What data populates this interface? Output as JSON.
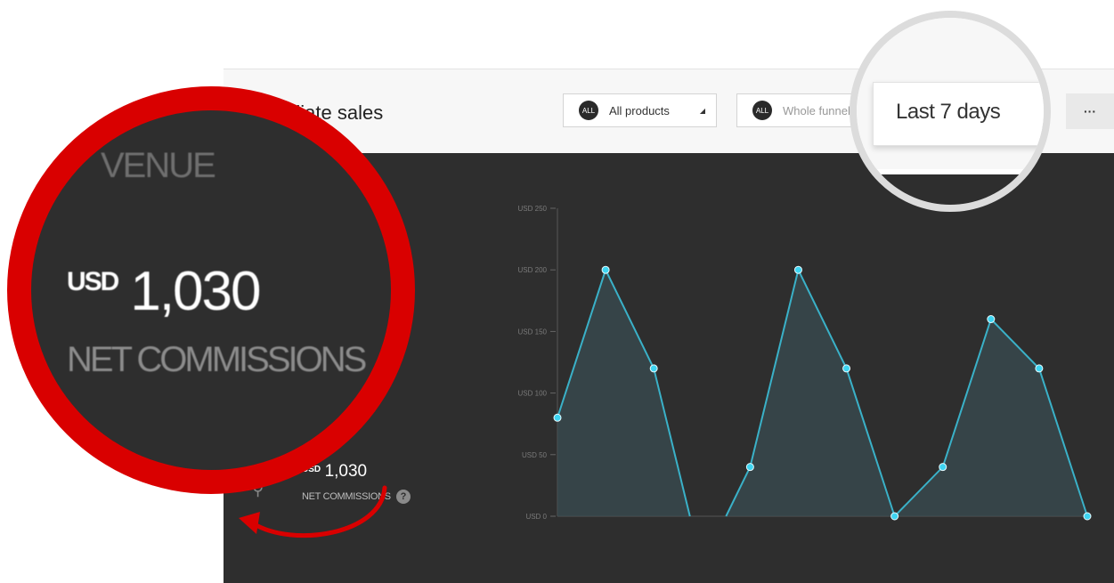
{
  "header": {
    "title": "Affiliate sales",
    "products_filter": {
      "badge": "ALL",
      "label": "All products"
    },
    "funnel_filter": {
      "badge": "ALL",
      "label": "Whole funnel"
    },
    "date_range": "Last 7 days",
    "more_label": "···"
  },
  "stats": {
    "currency": "USD",
    "amount": "1,030",
    "label": "NET COMMISSIONS",
    "help": "?"
  },
  "zoom": {
    "revenue_fragment": "VENUE",
    "currency": "USD",
    "amount": "1,030",
    "label": "NET COMMISSIONS"
  },
  "colors": {
    "accent": "#d90000",
    "line": "#3ab1c8",
    "point": "#3ed5f2",
    "panel": "#2e2e2e"
  },
  "chart_data": {
    "type": "area",
    "y_ticks": [
      "USD 0",
      "USD 50",
      "USD 100",
      "USD 150",
      "USD 200",
      "USD 250"
    ],
    "ylim": [
      0,
      250
    ],
    "segments": [
      [
        [
          0,
          80
        ],
        [
          1,
          200
        ],
        [
          2,
          120
        ],
        [
          2.75,
          0
        ]
      ],
      [
        [
          3.5,
          0
        ],
        [
          4,
          40
        ],
        [
          5,
          200
        ],
        [
          6,
          120
        ],
        [
          7,
          0
        ]
      ],
      [
        [
          7,
          0
        ],
        [
          8,
          40
        ],
        [
          9,
          160
        ],
        [
          10,
          120
        ],
        [
          11,
          0
        ]
      ]
    ],
    "points": [
      [
        0,
        80
      ],
      [
        1,
        200
      ],
      [
        2,
        120
      ],
      [
        4,
        40
      ],
      [
        5,
        200
      ],
      [
        6,
        120
      ],
      [
        7,
        0
      ],
      [
        8,
        40
      ],
      [
        9,
        160
      ],
      [
        10,
        120
      ],
      [
        11,
        0
      ]
    ],
    "xlim": [
      0,
      11
    ]
  }
}
